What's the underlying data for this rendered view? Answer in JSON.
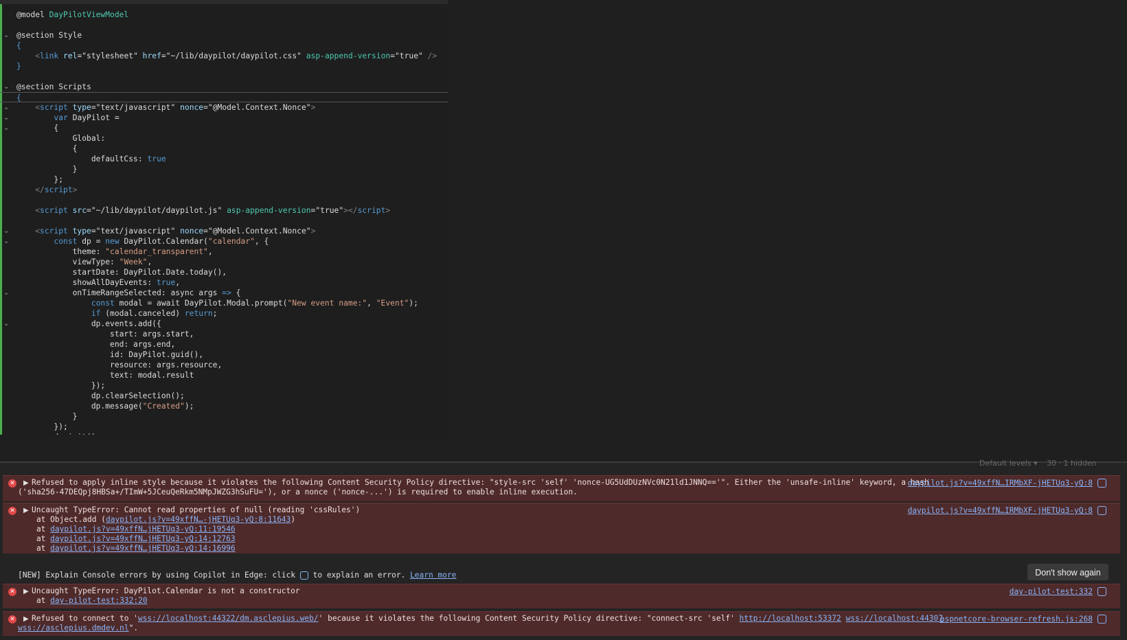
{
  "editor": {
    "lines": [
      {
        "fold": "",
        "segments": [
          {
            "t": "@model ",
            "c": "plain"
          },
          {
            "t": "DayPilotViewModel",
            "c": "tn"
          }
        ]
      },
      {
        "fold": "",
        "segments": []
      },
      {
        "fold": "v",
        "segments": [
          {
            "t": "@section ",
            "c": "plain"
          },
          {
            "t": "Style",
            "c": "plain"
          }
        ]
      },
      {
        "fold": "",
        "segments": [
          {
            "t": "{",
            "c": "kw"
          }
        ]
      },
      {
        "fold": "",
        "segments": [
          {
            "t": "    <",
            "c": "tag"
          },
          {
            "t": "link ",
            "c": "kw"
          },
          {
            "t": "rel",
            "c": "attr"
          },
          {
            "t": "=",
            "c": "plain"
          },
          {
            "t": "\"stylesheet\" ",
            "c": "plain"
          },
          {
            "t": "href",
            "c": "attr"
          },
          {
            "t": "=",
            "c": "plain"
          },
          {
            "t": "\"~/lib/daypilot/daypilot.css\" ",
            "c": "plain"
          },
          {
            "t": "asp-append-version",
            "c": "tn"
          },
          {
            "t": "=",
            "c": "plain"
          },
          {
            "t": "\"true\" ",
            "c": "plain"
          },
          {
            "t": "/>",
            "c": "tag"
          }
        ]
      },
      {
        "fold": "",
        "segments": [
          {
            "t": "}",
            "c": "kw"
          }
        ]
      },
      {
        "fold": "",
        "segments": []
      },
      {
        "fold": "v",
        "segments": [
          {
            "t": "@section ",
            "c": "plain"
          },
          {
            "t": "Scripts",
            "c": "plain"
          }
        ]
      },
      {
        "fold": "",
        "segments": [
          {
            "t": "{",
            "c": "kw"
          }
        ]
      },
      {
        "fold": "v",
        "segments": [
          {
            "t": "    <",
            "c": "tag"
          },
          {
            "t": "script ",
            "c": "kw"
          },
          {
            "t": "type",
            "c": "attr"
          },
          {
            "t": "=",
            "c": "plain"
          },
          {
            "t": "\"text/javascript\" ",
            "c": "plain"
          },
          {
            "t": "nonce",
            "c": "attr"
          },
          {
            "t": "=",
            "c": "plain"
          },
          {
            "t": "\"@Model.Context.Nonce\"",
            "c": "plain"
          },
          {
            "t": ">",
            "c": "tag"
          }
        ]
      },
      {
        "fold": "v",
        "segments": [
          {
            "t": "        ",
            "c": "plain"
          },
          {
            "t": "var ",
            "c": "kw"
          },
          {
            "t": "DayPilot =",
            "c": "plain"
          }
        ]
      },
      {
        "fold": "v",
        "segments": [
          {
            "t": "        {",
            "c": "plain"
          }
        ]
      },
      {
        "fold": "",
        "segments": [
          {
            "t": "            Global:",
            "c": "plain"
          }
        ]
      },
      {
        "fold": "",
        "segments": [
          {
            "t": "            {",
            "c": "plain"
          }
        ]
      },
      {
        "fold": "",
        "segments": [
          {
            "t": "                defaultCss: ",
            "c": "plain"
          },
          {
            "t": "true",
            "c": "kw"
          }
        ]
      },
      {
        "fold": "",
        "segments": [
          {
            "t": "            }",
            "c": "plain"
          }
        ]
      },
      {
        "fold": "",
        "segments": [
          {
            "t": "        };",
            "c": "plain"
          }
        ]
      },
      {
        "fold": "",
        "segments": [
          {
            "t": "    </",
            "c": "tag"
          },
          {
            "t": "script",
            "c": "kw"
          },
          {
            "t": ">",
            "c": "tag"
          }
        ]
      },
      {
        "fold": "",
        "segments": []
      },
      {
        "fold": "",
        "segments": [
          {
            "t": "    <",
            "c": "tag"
          },
          {
            "t": "script ",
            "c": "kw"
          },
          {
            "t": "src",
            "c": "attr"
          },
          {
            "t": "=",
            "c": "plain"
          },
          {
            "t": "\"~/lib/daypilot/daypilot.js\" ",
            "c": "plain"
          },
          {
            "t": "asp-append-version",
            "c": "tn"
          },
          {
            "t": "=",
            "c": "plain"
          },
          {
            "t": "\"true\"",
            "c": "plain"
          },
          {
            "t": "></",
            "c": "tag"
          },
          {
            "t": "script",
            "c": "kw"
          },
          {
            "t": ">",
            "c": "tag"
          }
        ]
      },
      {
        "fold": "",
        "segments": []
      },
      {
        "fold": "v",
        "segments": [
          {
            "t": "    <",
            "c": "tag"
          },
          {
            "t": "script ",
            "c": "kw"
          },
          {
            "t": "type",
            "c": "attr"
          },
          {
            "t": "=",
            "c": "plain"
          },
          {
            "t": "\"text/javascript\" ",
            "c": "plain"
          },
          {
            "t": "nonce",
            "c": "attr"
          },
          {
            "t": "=",
            "c": "plain"
          },
          {
            "t": "\"@Model.Context.Nonce\"",
            "c": "plain"
          },
          {
            "t": ">",
            "c": "tag"
          }
        ]
      },
      {
        "fold": "v",
        "segments": [
          {
            "t": "        ",
            "c": "plain"
          },
          {
            "t": "const ",
            "c": "kw"
          },
          {
            "t": "dp = ",
            "c": "plain"
          },
          {
            "t": "new ",
            "c": "kw"
          },
          {
            "t": "DayPilot.Calendar(",
            "c": "plain"
          },
          {
            "t": "\"calendar\"",
            "c": "str"
          },
          {
            "t": ", {",
            "c": "plain"
          }
        ]
      },
      {
        "fold": "",
        "segments": [
          {
            "t": "            theme: ",
            "c": "plain"
          },
          {
            "t": "\"calendar_transparent\"",
            "c": "str"
          },
          {
            "t": ",",
            "c": "plain"
          }
        ]
      },
      {
        "fold": "",
        "segments": [
          {
            "t": "            viewType: ",
            "c": "plain"
          },
          {
            "t": "\"Week\"",
            "c": "str"
          },
          {
            "t": ",",
            "c": "plain"
          }
        ]
      },
      {
        "fold": "",
        "segments": [
          {
            "t": "            startDate: DayPilot.Date.today(),",
            "c": "plain"
          }
        ]
      },
      {
        "fold": "",
        "segments": [
          {
            "t": "            showAllDayEvents: ",
            "c": "plain"
          },
          {
            "t": "true",
            "c": "kw"
          },
          {
            "t": ",",
            "c": "plain"
          }
        ]
      },
      {
        "fold": "v",
        "segments": [
          {
            "t": "            onTimeRangeSelected: async args ",
            "c": "plain"
          },
          {
            "t": "=>",
            "c": "kw"
          },
          {
            "t": " {",
            "c": "plain"
          }
        ]
      },
      {
        "fold": "",
        "segments": [
          {
            "t": "                ",
            "c": "plain"
          },
          {
            "t": "const ",
            "c": "kw"
          },
          {
            "t": "modal = await DayPilot.Modal.prompt(",
            "c": "plain"
          },
          {
            "t": "\"New event name:\"",
            "c": "str"
          },
          {
            "t": ", ",
            "c": "plain"
          },
          {
            "t": "\"Event\"",
            "c": "str"
          },
          {
            "t": ");",
            "c": "plain"
          }
        ]
      },
      {
        "fold": "",
        "segments": [
          {
            "t": "                ",
            "c": "plain"
          },
          {
            "t": "if ",
            "c": "kw"
          },
          {
            "t": "(modal.canceled) ",
            "c": "plain"
          },
          {
            "t": "return",
            "c": "kw"
          },
          {
            "t": ";",
            "c": "plain"
          }
        ]
      },
      {
        "fold": "v",
        "segments": [
          {
            "t": "                dp.events.add({",
            "c": "plain"
          }
        ]
      },
      {
        "fold": "",
        "segments": [
          {
            "t": "                    start: args.start,",
            "c": "plain"
          }
        ]
      },
      {
        "fold": "",
        "segments": [
          {
            "t": "                    end: args.end,",
            "c": "plain"
          }
        ]
      },
      {
        "fold": "",
        "segments": [
          {
            "t": "                    id: DayPilot.guid(),",
            "c": "plain"
          }
        ]
      },
      {
        "fold": "",
        "segments": [
          {
            "t": "                    resource: args.resource,",
            "c": "plain"
          }
        ]
      },
      {
        "fold": "",
        "segments": [
          {
            "t": "                    text: modal.result",
            "c": "plain"
          }
        ]
      },
      {
        "fold": "",
        "segments": [
          {
            "t": "                });",
            "c": "plain"
          }
        ]
      },
      {
        "fold": "",
        "segments": [
          {
            "t": "                dp.clearSelection();",
            "c": "plain"
          }
        ]
      },
      {
        "fold": "",
        "segments": [
          {
            "t": "                dp.message(",
            "c": "plain"
          },
          {
            "t": "\"Created\"",
            "c": "str"
          },
          {
            "t": ");",
            "c": "plain"
          }
        ]
      },
      {
        "fold": "",
        "segments": [
          {
            "t": "            }",
            "c": "plain"
          }
        ]
      },
      {
        "fold": "",
        "segments": [
          {
            "t": "        });",
            "c": "plain"
          }
        ]
      },
      {
        "fold": "",
        "segments": [
          {
            "t": "        dp.init();",
            "c": "plain"
          }
        ]
      }
    ]
  },
  "console": {
    "toolbar_ghost": {
      "levels": "Default levels ▾",
      "hidden": "30 · 1 hidden"
    },
    "messages": [
      {
        "id": "csp-style",
        "line1": "Refused to apply inline style because it violates the following Content Security Policy directive: \"style-src 'self' 'nonce-UG5UdDUzNVc0N21ld1JNNQ=='\". Either the 'unsafe-inline' keyword, a hash",
        "line2": "('sha256-47DEQpj8HBSa+/TImW+5JCeuQeRkm5NMpJWZG3hSuFU='), or a nonce ('nonce-...') is required to enable inline execution.",
        "source": "daypilot.js?v=49xffN…IRMbXF-jHETUq3-yQ:8"
      },
      {
        "id": "typeerror-cssrules",
        "line1": "Uncaught TypeError: Cannot read properties of null (reading 'cssRules')",
        "stack": [
          {
            "prefix": "    at Object.add (",
            "link": "daypilot.js?v=49xffN…-jHETUq3-yQ:8:11643",
            "suffix": ")"
          },
          {
            "prefix": "    at ",
            "link": "daypilot.js?v=49xffN…jHETUq3-yQ:11:19546",
            "suffix": ""
          },
          {
            "prefix": "    at ",
            "link": "daypilot.js?v=49xffN…jHETUq3-yQ:14:12763",
            "suffix": ""
          },
          {
            "prefix": "    at ",
            "link": "daypilot.js?v=49xffN…jHETUq3-yQ:14:16996",
            "suffix": ""
          }
        ],
        "source": "daypilot.js?v=49xffN…IRMbXF-jHETUq3-yQ:8"
      },
      {
        "id": "typeerror-constructor",
        "line1": "Uncaught TypeError: DayPilot.Calendar is not a constructor",
        "stack": [
          {
            "prefix": "    at ",
            "link": "day-pilot-test:332:20",
            "suffix": ""
          }
        ],
        "source": "day-pilot-test:332"
      },
      {
        "id": "csp-connect",
        "line1_a": "Refused to connect to '",
        "line1_link": "wss://localhost:44322/dm.asclepius.web/",
        "line1_b": "' because it violates the following Content Security Policy directive: \"connect-src 'self' ",
        "line1_link2": "http://localhost:53372",
        "line1_c": " ",
        "line1_link3": "wss://localhost:44307",
        "line2_link": "wss://asclepius.dmdev.nl",
        "line2_b": "\".",
        "source": "aspnetcore-browser-refresh.js:268"
      }
    ],
    "copilot_banner": {
      "text_a": "[NEW] Explain Console errors by using Copilot in Edge: click ",
      "text_b": " to explain an error. ",
      "learn_more": "Learn more",
      "dont_show": "Don't show again"
    }
  }
}
